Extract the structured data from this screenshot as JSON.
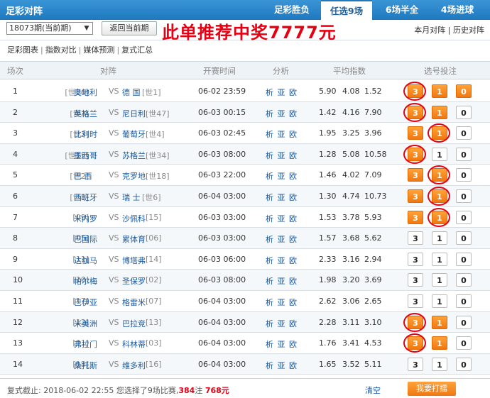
{
  "header": {
    "title": "足彩对阵",
    "tabs": [
      {
        "label": "足彩胜负",
        "active": false
      },
      {
        "label": "任选9场",
        "active": true
      },
      {
        "label": "6场半全",
        "active": false
      },
      {
        "label": "4场进球",
        "active": false
      }
    ]
  },
  "controls": {
    "period_selected": "18073期(当前期)",
    "return_button": "返回当前期",
    "promo_text": "此单推荐中奖7777元",
    "link_month": "本月对阵",
    "link_separator": "|",
    "link_history": "历史对阵"
  },
  "subnav": {
    "items": [
      "足彩图表",
      "指数对比",
      "媒体预测",
      "复式汇总"
    ],
    "separator": "|"
  },
  "table": {
    "headers": [
      "场次",
      "对阵",
      "开赛时间",
      "分析",
      "平均指数",
      "选号投注"
    ],
    "rows": [
      {
        "no": "1",
        "home_rank": "[世26]",
        "home": "奥地利",
        "vs": "VS",
        "away": "德 国",
        "away_rank": "[世1]",
        "time": "06-02 23:59",
        "analysis": "析 亚 欧",
        "odds": [
          "5.90",
          "4.08",
          "1.52"
        ],
        "picks": [
          "3",
          "1",
          "0"
        ]
      },
      {
        "no": "2",
        "home_rank": "[世3]",
        "home": "英格兰",
        "vs": "VS",
        "away": "尼日利",
        "away_rank": "[世47]",
        "time": "06-03 00:15",
        "analysis": "析 亚 欧",
        "odds": [
          "1.42",
          "4.16",
          "7.90"
        ],
        "picks": [
          "3",
          "1",
          "0"
        ]
      },
      {
        "no": "3",
        "home_rank": "[世3]",
        "home": "比利时",
        "vs": "VS",
        "away": "葡萄牙",
        "away_rank": "[世4]",
        "time": "06-03 02:45",
        "analysis": "析 亚 欧",
        "odds": [
          "1.95",
          "3.25",
          "3.96"
        ],
        "picks": [
          "3",
          "1",
          "0"
        ]
      },
      {
        "no": "4",
        "home_rank": "[世15]",
        "home": "墨西哥",
        "vs": "VS",
        "away": "苏格兰",
        "away_rank": "[世34]",
        "time": "06-03 08:00",
        "analysis": "析 亚 欧",
        "odds": [
          "1.28",
          "5.08",
          "10.58"
        ],
        "picks": [
          "3",
          "1",
          "0"
        ]
      },
      {
        "no": "5",
        "home_rank": "[世2]",
        "home": "巴 西",
        "vs": "VS",
        "away": "克罗地",
        "away_rank": "[世18]",
        "time": "06-03 22:00",
        "analysis": "析 亚 欧",
        "odds": [
          "1.46",
          "4.02",
          "7.09"
        ],
        "picks": [
          "3",
          "1",
          "0"
        ]
      },
      {
        "no": "6",
        "home_rank": "[世8]",
        "home": "西班牙",
        "vs": "VS",
        "away": "瑞 士",
        "away_rank": "[世6]",
        "time": "06-04 03:00",
        "analysis": "析 亚 欧",
        "odds": [
          "1.30",
          "4.74",
          "10.73"
        ],
        "picks": [
          "3",
          "1",
          "0"
        ]
      },
      {
        "no": "7",
        "home_rank": "[09]",
        "home": "米内罗",
        "vs": "VS",
        "away": "沙佩科",
        "away_rank": "[15]",
        "time": "06-03 03:00",
        "analysis": "析 亚 欧",
        "odds": [
          "1.53",
          "3.78",
          "5.93"
        ],
        "picks": [
          "3",
          "1",
          "0"
        ]
      },
      {
        "no": "8",
        "home_rank": "[05]",
        "home": "巴国际",
        "vs": "VS",
        "away": "累体育",
        "away_rank": "[06]",
        "time": "06-03 03:00",
        "analysis": "析 亚 欧",
        "odds": [
          "1.57",
          "3.68",
          "5.62"
        ],
        "picks": [
          "3",
          "1",
          "0"
        ]
      },
      {
        "no": "9",
        "home_rank": "[11]",
        "home": "达伽马",
        "vs": "VS",
        "away": "博塔弗",
        "away_rank": "[14]",
        "time": "06-03 06:00",
        "analysis": "析 亚 欧",
        "odds": [
          "2.33",
          "3.16",
          "2.94"
        ],
        "picks": [
          "3",
          "1",
          "0"
        ]
      },
      {
        "no": "10",
        "home_rank": "[10]",
        "home": "帕尔梅",
        "vs": "VS",
        "away": "圣保罗",
        "away_rank": "[02]",
        "time": "06-03 08:00",
        "analysis": "析 亚 欧",
        "odds": [
          "1.98",
          "3.20",
          "3.69"
        ],
        "picks": [
          "3",
          "1",
          "0"
        ]
      },
      {
        "no": "11",
        "home_rank": "[17]",
        "home": "巴伊亚",
        "vs": "VS",
        "away": "格雷米",
        "away_rank": "[07]",
        "time": "06-04 03:00",
        "analysis": "析 亚 欧",
        "odds": [
          "2.62",
          "3.06",
          "2.65"
        ],
        "picks": [
          "3",
          "1",
          "0"
        ]
      },
      {
        "no": "12",
        "home_rank": "[12]",
        "home": "米美洲",
        "vs": "VS",
        "away": "巴拉竞",
        "away_rank": "[13]",
        "time": "06-04 03:00",
        "analysis": "析 亚 欧",
        "odds": [
          "2.28",
          "3.11",
          "3.10"
        ],
        "picks": [
          "3",
          "1",
          "0"
        ]
      },
      {
        "no": "13",
        "home_rank": "[01]",
        "home": "弗拉门",
        "vs": "VS",
        "away": "科林蒂",
        "away_rank": "[03]",
        "time": "06-04 03:00",
        "analysis": "析 亚 欧",
        "odds": [
          "1.76",
          "3.41",
          "4.53"
        ],
        "picks": [
          "3",
          "1",
          "0"
        ]
      },
      {
        "no": "14",
        "home_rank": "[18]",
        "home": "桑托斯",
        "vs": "VS",
        "away": "维多利",
        "away_rank": "[16]",
        "time": "06-04 03:00",
        "analysis": "析 亚 欧",
        "odds": [
          "1.65",
          "3.52",
          "5.11"
        ],
        "picks": [
          "3",
          "1",
          "0"
        ]
      }
    ],
    "selected": [
      [
        true,
        true,
        true
      ],
      [
        true,
        true,
        false
      ],
      [
        true,
        true,
        false
      ],
      [
        true,
        false,
        false
      ],
      [
        true,
        true,
        false
      ],
      [
        true,
        true,
        false
      ],
      [
        true,
        true,
        false
      ],
      [
        false,
        false,
        false
      ],
      [
        false,
        false,
        false
      ],
      [
        false,
        false,
        false
      ],
      [
        false,
        false,
        false
      ],
      [
        true,
        true,
        false
      ],
      [
        true,
        true,
        false
      ],
      [
        false,
        false,
        false
      ]
    ],
    "circled": [
      [
        true,
        false,
        false
      ],
      [
        true,
        false,
        false
      ],
      [
        false,
        true,
        false
      ],
      [
        true,
        false,
        false
      ],
      [
        false,
        true,
        false
      ],
      [
        false,
        true,
        false
      ],
      [
        false,
        true,
        false
      ],
      [
        false,
        false,
        false
      ],
      [
        false,
        false,
        false
      ],
      [
        false,
        false,
        false
      ],
      [
        false,
        false,
        false
      ],
      [
        true,
        false,
        false
      ],
      [
        true,
        false,
        false
      ],
      [
        false,
        false,
        false
      ]
    ]
  },
  "footer": {
    "label": "复式截止:",
    "deadline": "2018-06-02 22:55",
    "summary_pre": "您选择了9场比赛,",
    "bets": "384",
    "bets_unit": "注",
    "amount": "768元",
    "clear": "清空",
    "bet_button": "我要打擂"
  },
  "colors": {
    "header_blue": "#1f79bf",
    "pick_orange": "#f07810",
    "ring_red": "#e60012",
    "promo_red": "#e60012"
  }
}
